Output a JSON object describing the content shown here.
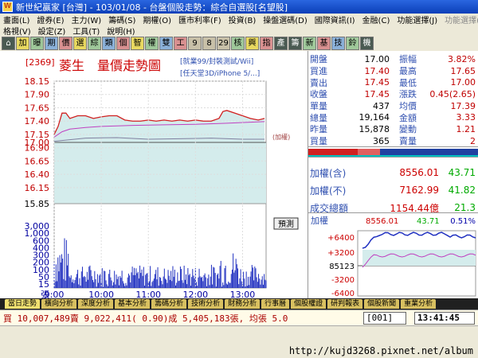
{
  "window": {
    "title": "新世紀贏家 [台灣] - 103/01/08 - 台盤個股走勢：綜合自選股[名望股]"
  },
  "menu": {
    "row1": [
      "畫面(L)",
      "證券(E)",
      "主力(W)",
      "籌碼(S)",
      "期權(O)",
      "匯市利率(F)",
      "投資(B)",
      "操盤選碼(D)",
      "國際資訊(I)",
      "金融(C)",
      "功能選擇(J)",
      "功能選擇(K)"
    ],
    "row2": [
      "格視(V)",
      "設定(Z)",
      "工具(T)",
      "說明(H)"
    ]
  },
  "toolbar": {
    "buttons": [
      "⌂",
      "加",
      "曝",
      "期",
      "價",
      "選",
      "綜",
      "類",
      "個",
      "智",
      "權",
      "雙",
      "工",
      "9",
      "8",
      "29",
      "核",
      "興",
      "指",
      "產",
      "籌",
      "新",
      "基",
      "技",
      "鈴",
      "機"
    ]
  },
  "header": {
    "code": "[2369]",
    "name": "菱生",
    "chart_title": "量價走勢圖",
    "sub1": "[就業99/封裝測試/Wii]",
    "sub2": "[任天堂3D/iPhone 5/...]",
    "ref_tag": "(加權)",
    "predict_label": "預測"
  },
  "chart_data": {
    "type": "line",
    "price_ticks": [
      "18.15",
      "17.90",
      "17.65",
      "17.40",
      "17.15",
      "16.90",
      "16.65",
      "16.40",
      "16.15",
      "15.85"
    ],
    "price_levels": [
      18.15,
      17.9,
      17.65,
      17.4,
      17.15,
      16.9,
      16.65,
      16.4,
      16.15,
      15.85
    ],
    "ref_price": "17.00",
    "ref_value": 17.0,
    "volume_ticks": [
      "3,000",
      "1,000",
      "600",
      "400",
      "300",
      "200",
      "100",
      "50",
      "15"
    ],
    "volume_unit": "張",
    "time_ticks": [
      "9:00",
      "10:00",
      "11:00",
      "12:00",
      "13:00"
    ],
    "time_values": [
      0,
      60,
      120,
      180,
      240
    ],
    "session_minutes": 270,
    "price_series": [
      [
        0,
        17.15
      ],
      [
        5,
        17.3
      ],
      [
        10,
        17.55
      ],
      [
        15,
        17.55
      ],
      [
        20,
        17.45
      ],
      [
        30,
        17.5
      ],
      [
        40,
        17.5
      ],
      [
        50,
        17.45
      ],
      [
        60,
        17.48
      ],
      [
        70,
        17.5
      ],
      [
        80,
        17.5
      ],
      [
        90,
        17.42
      ],
      [
        100,
        17.4
      ],
      [
        110,
        17.4
      ],
      [
        120,
        17.42
      ],
      [
        130,
        17.4
      ],
      [
        140,
        17.42
      ],
      [
        150,
        17.4
      ],
      [
        160,
        17.42
      ],
      [
        170,
        17.4
      ],
      [
        180,
        17.42
      ],
      [
        190,
        17.4
      ],
      [
        200,
        17.4
      ],
      [
        210,
        17.45
      ],
      [
        215,
        17.58
      ],
      [
        220,
        17.6
      ],
      [
        230,
        17.55
      ],
      [
        240,
        17.5
      ],
      [
        250,
        17.45
      ],
      [
        260,
        17.42
      ],
      [
        268,
        17.45
      ]
    ],
    "avg_series": [
      [
        0,
        17.1
      ],
      [
        10,
        17.2
      ],
      [
        20,
        17.25
      ],
      [
        40,
        17.28
      ],
      [
        60,
        17.3
      ],
      [
        100,
        17.32
      ],
      [
        140,
        17.33
      ],
      [
        180,
        17.34
      ],
      [
        220,
        17.36
      ],
      [
        268,
        17.39
      ]
    ],
    "index_series": [
      [
        0,
        17.02
      ],
      [
        40,
        17.08
      ],
      [
        80,
        17.09
      ],
      [
        120,
        17.06
      ],
      [
        160,
        17.07
      ],
      [
        200,
        17.08
      ],
      [
        240,
        17.06
      ],
      [
        268,
        17.06
      ]
    ]
  },
  "quote": {
    "rows": [
      {
        "l": "開盤",
        "v": "17.00",
        "l2": "振幅",
        "v2": "3.82%"
      },
      {
        "l": "買進",
        "v": "17.40",
        "l2": "最高",
        "v2": "17.65"
      },
      {
        "l": "賣出",
        "v": "17.45",
        "l2": "最低",
        "v2": "17.00"
      },
      {
        "l": "收盤",
        "v": "17.45",
        "l2": "漲跌",
        "v2": "0.45(2.65)"
      },
      {
        "l": "單量",
        "v": "437",
        "l2": "均價",
        "v2": "17.39"
      },
      {
        "l": "總量",
        "v": "19,164",
        "l2": "金額",
        "v2": "3.33"
      },
      {
        "l": "昨量",
        "v": "15,878",
        "l2": "變動",
        "v2": "1.21"
      },
      {
        "l": "買量",
        "v": "365",
        "l2": "賣量",
        "v2": "2"
      }
    ]
  },
  "index": {
    "rows": [
      {
        "l": "加權(含)",
        "v": "8556.01",
        "v2": "43.71"
      },
      {
        "l": "加權(不)",
        "v": "7162.99",
        "v2": "41.82"
      },
      {
        "l": "成交總額",
        "v": "1154.44億",
        "v2": "21.3"
      }
    ],
    "mini_label": "加權",
    "mini_value": "8556.01",
    "mini_change": "43.71",
    "mini_pct": "0.51%",
    "mini_ticks": [
      "+6400",
      "+3200",
      "85123",
      "-3200",
      "-6400"
    ]
  },
  "tabs": [
    "當日走勢",
    "橫向分析",
    "深度分析",
    "基本分析",
    "籌碼分析",
    "技術分析",
    "財務分析",
    "行事曆",
    "個股權證",
    "研判報表",
    "個股新聞",
    "重業分析"
  ],
  "status": {
    "text": "買 10,007,489賣 9,022,411( 0.90)成 5,405,183張, 均張 5.0",
    "code": "001",
    "time": "13:41:45"
  },
  "url": "http://kujd3268.pixnet.net/album",
  "colors": {
    "price": "#d02020",
    "avg": "#c040c0",
    "index": "#8080a0",
    "fill": "#d4ecec",
    "up": "#c00000",
    "down": "#008000",
    "blue": "#3050b0"
  }
}
